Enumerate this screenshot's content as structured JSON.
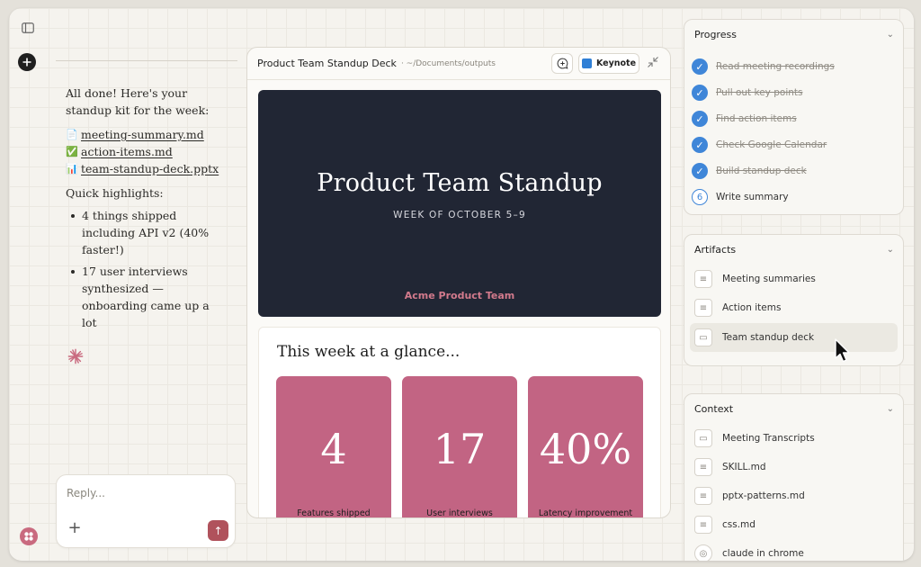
{
  "chat": {
    "intro": "All done! Here's your standup kit for the week:",
    "files": [
      {
        "icon": "📄",
        "name": "meeting-summary.md"
      },
      {
        "icon": "✅",
        "name": "action-items.md"
      },
      {
        "icon": "📊",
        "name": "team-standup-deck.pptx"
      }
    ],
    "highlights_heading": "Quick highlights:",
    "highlights": [
      "4 things shipped including API v2 (40% faster!)",
      "17 user interviews synthesized — onboarding came up a lot"
    ]
  },
  "reply": {
    "placeholder": "Reply...",
    "plus": "+",
    "send": "↑"
  },
  "preview": {
    "title": "Product Team Standup Deck",
    "path": "· ~/Documents/outputs",
    "keynote_label": "Keynote",
    "slide1": {
      "title": "Product Team Standup",
      "subtitle": "WEEK OF OCTOBER 5–9",
      "team": "Acme Product Team"
    },
    "slide2": {
      "title": "This week at a glance...",
      "stats": [
        {
          "value": "4",
          "label": "Features shipped"
        },
        {
          "value": "17",
          "label": "User interviews"
        },
        {
          "value": "40%",
          "label": "Latency improvement"
        }
      ]
    }
  },
  "progress": {
    "title": "Progress",
    "items": [
      {
        "label": "Read meeting recordings",
        "done": true
      },
      {
        "label": "Pull out key points",
        "done": true
      },
      {
        "label": "Find action items",
        "done": true
      },
      {
        "label": "Check Google Calendar",
        "done": true
      },
      {
        "label": "Build standup deck",
        "done": true
      },
      {
        "label": "Write summary",
        "done": false
      }
    ],
    "current_step": "6"
  },
  "artifacts": {
    "title": "Artifacts",
    "items": [
      "Meeting summaries",
      "Action items",
      "Team standup deck"
    ]
  },
  "context": {
    "title": "Context",
    "items": [
      "Meeting Transcripts",
      "SKILL.md",
      "pptx-patterns.md",
      "css.md",
      "claude in chrome"
    ]
  },
  "colors": {
    "accent": "#c26483",
    "slide_bg": "#212634",
    "check_blue": "#3f86d8",
    "send_button": "#b0525c"
  }
}
